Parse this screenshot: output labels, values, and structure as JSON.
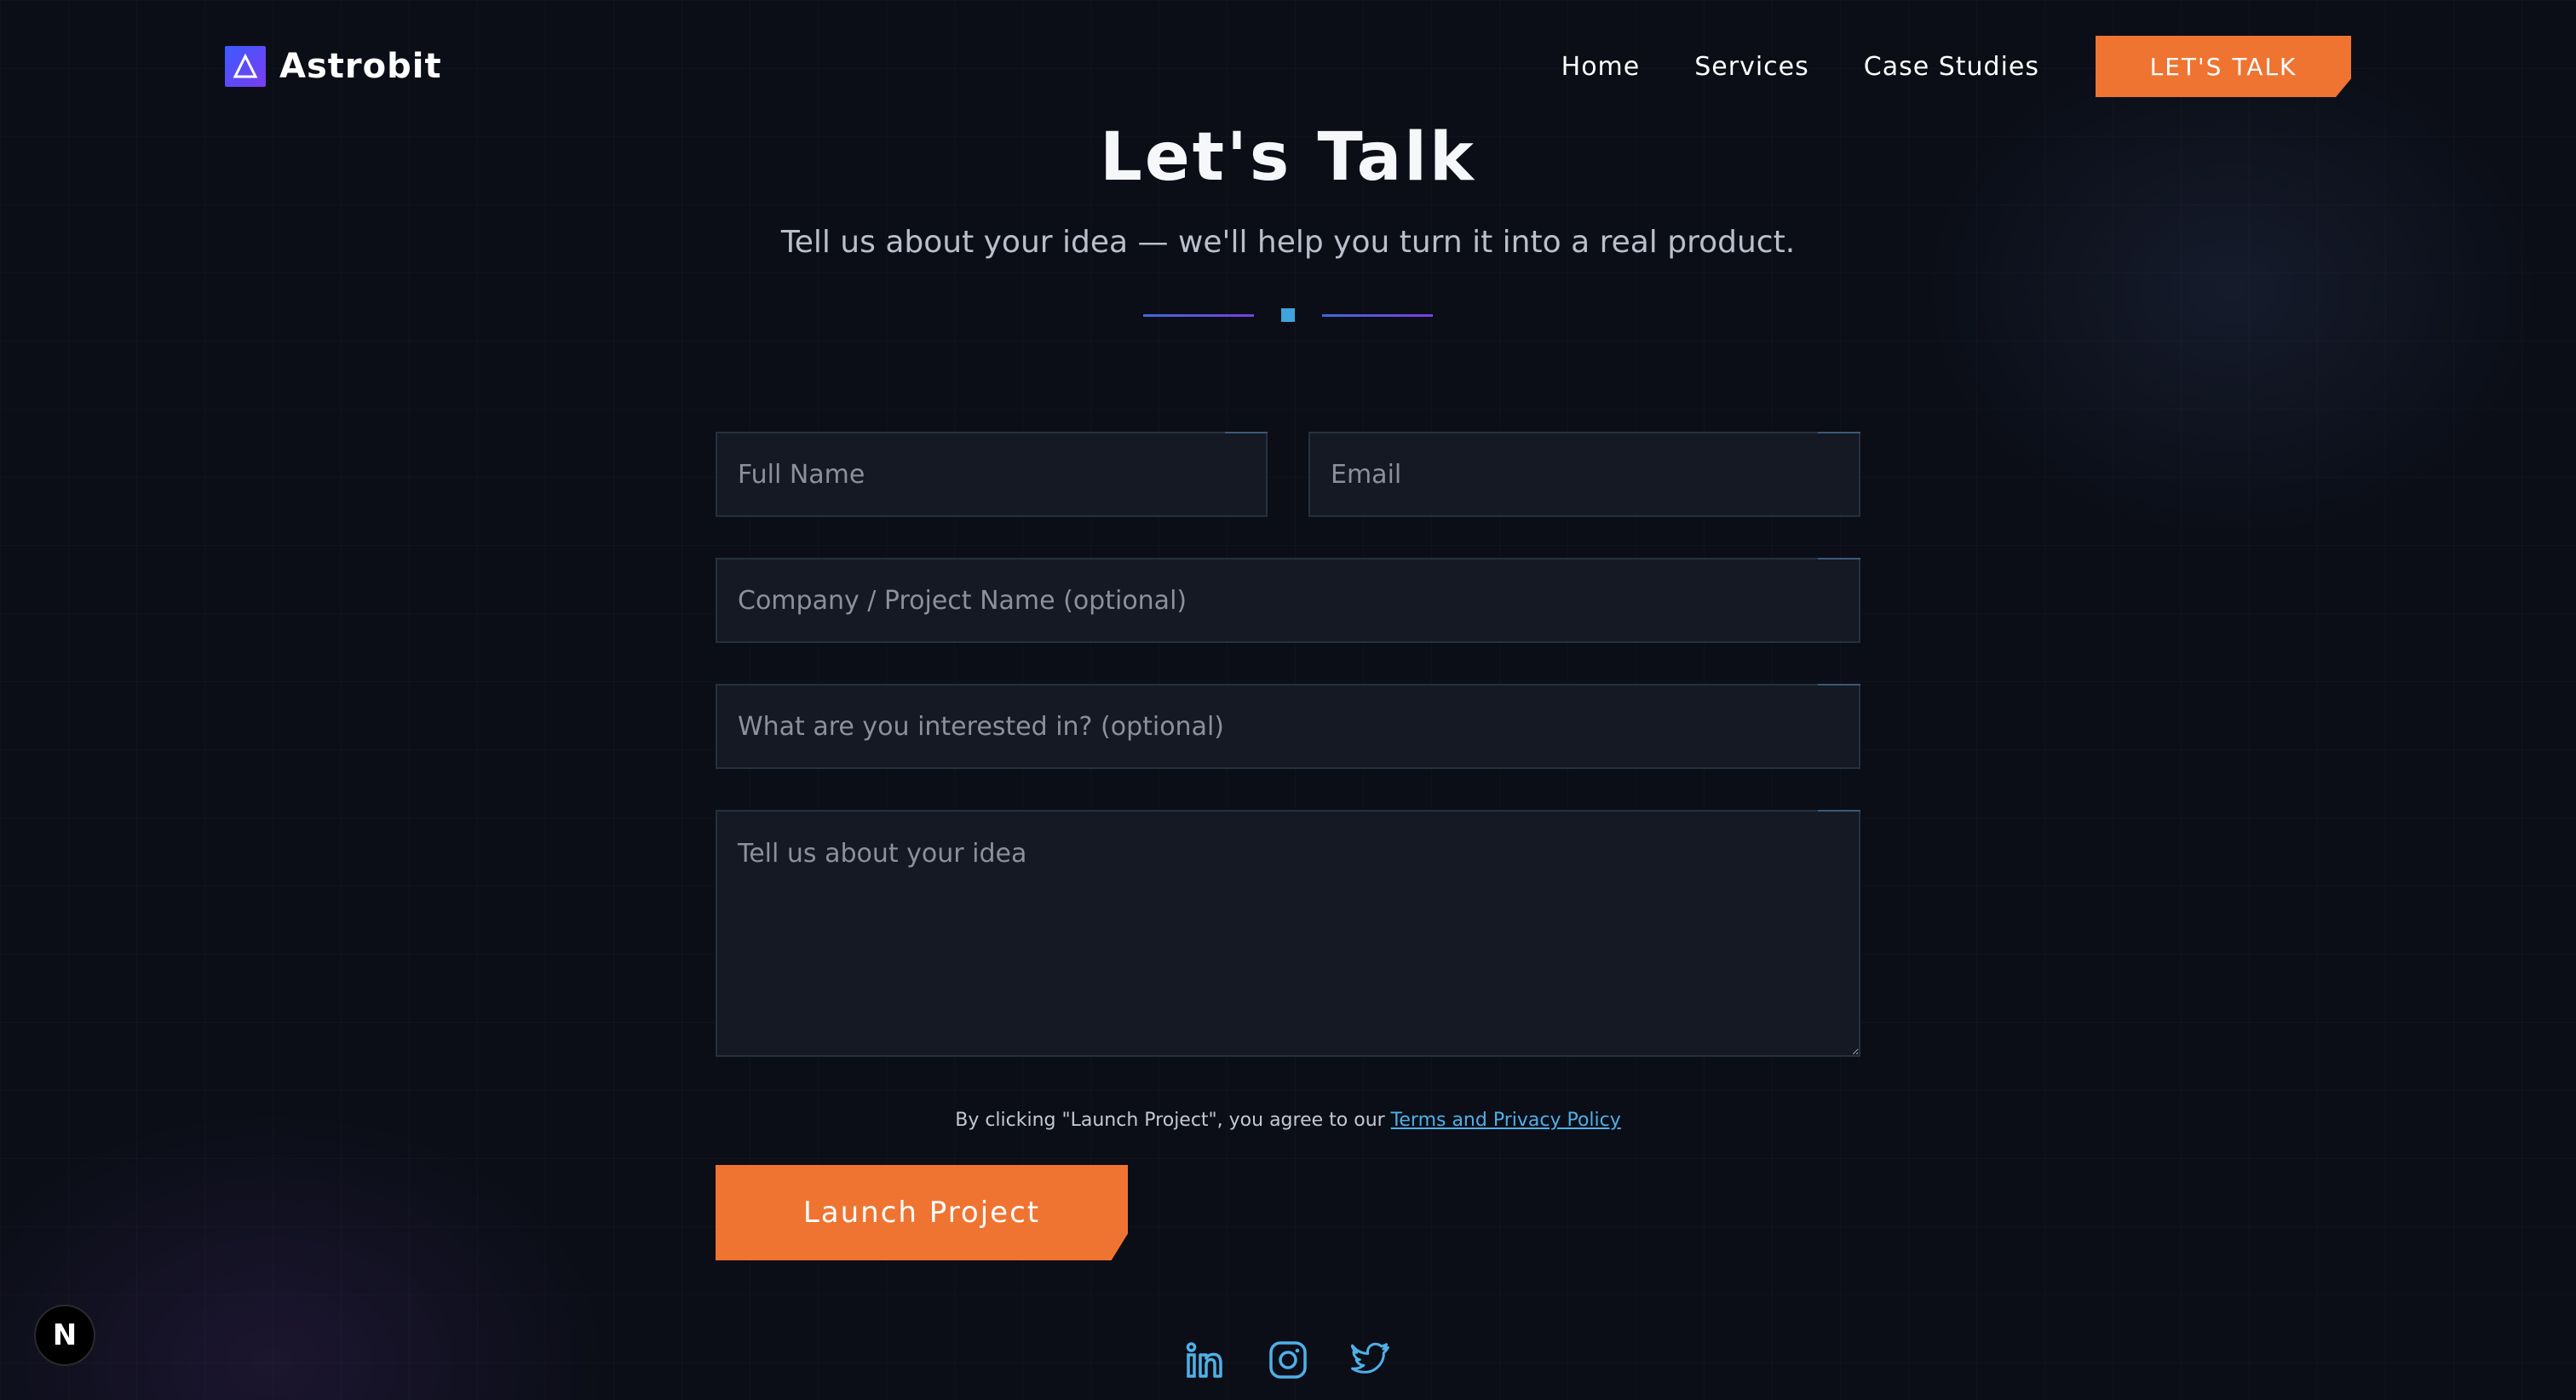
{
  "brand": {
    "name": "Astrobit",
    "logo_icon": "delta-triangle-icon"
  },
  "nav": {
    "links": [
      "Home",
      "Services",
      "Case Studies"
    ],
    "cta_label": "LET'S TALK"
  },
  "hero": {
    "title": "Let's Talk",
    "subtitle": "Tell us about your idea — we'll help you turn it into a real product."
  },
  "form": {
    "full_name_placeholder": "Full Name",
    "email_placeholder": "Email",
    "company_placeholder": "Company / Project Name (optional)",
    "interest_placeholder": "What are you interested in? (optional)",
    "idea_placeholder": "Tell us about your idea"
  },
  "agreement": {
    "text": "By clicking \"Launch Project\", you agree to our ",
    "link_text": "Terms and Privacy Policy"
  },
  "submit_label": "Launch Project",
  "socials": [
    "linkedin-icon",
    "instagram-icon",
    "twitter-icon"
  ],
  "dev_badge": "N",
  "colors": {
    "background": "#0b0e17",
    "accent_orange": "#ef7432",
    "accent_blue": "#3fa4dc",
    "field_bg": "#141923"
  }
}
